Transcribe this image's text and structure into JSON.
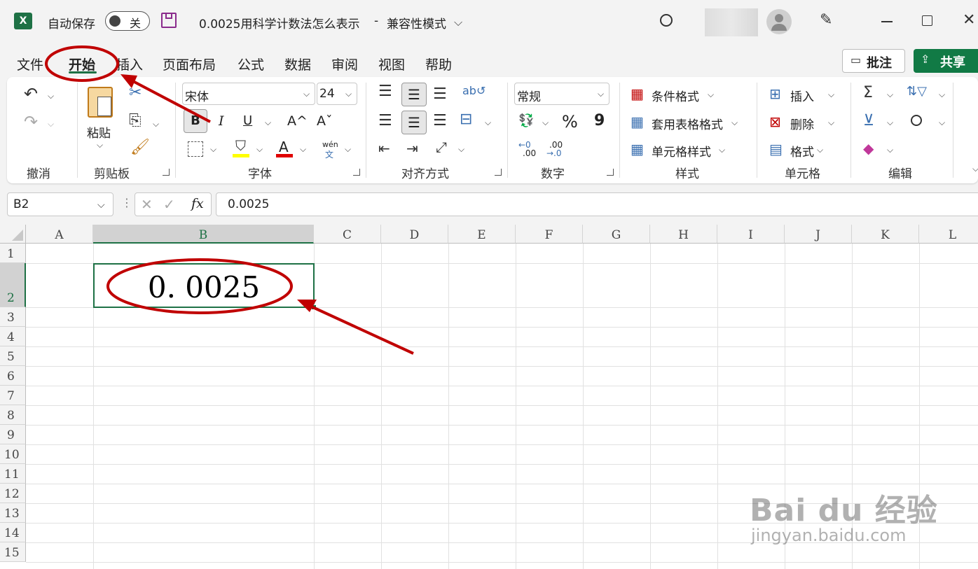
{
  "app": {
    "autosave_label": "自动保存",
    "autosave_state": "关",
    "doc_title": "0.0025用科学计数法怎么表示",
    "title_sep": "-",
    "mode": "兼容性模式"
  },
  "tabs": [
    "文件",
    "开始",
    "插入",
    "页面布局",
    "公式",
    "数据",
    "审阅",
    "视图",
    "帮助"
  ],
  "active_tab": "开始",
  "comments_label": "批注",
  "share_label": "共享",
  "ribbon": {
    "groups": {
      "undo": "撤消",
      "clipboard": "剪贴板",
      "font": "字体",
      "alignment": "对齐方式",
      "number": "数字",
      "styles": "样式",
      "cells": "单元格",
      "editing": "编辑"
    },
    "paste_label": "粘贴",
    "font_name": "宋体",
    "font_size": "24",
    "bold": "B",
    "italic": "I",
    "underline": "U",
    "grow": "A^",
    "shrink": "Aˇ",
    "phonetic_top": "wén",
    "phonetic_bottom": "文",
    "number_format": "常规",
    "percent": "%",
    "comma": "9",
    "dec_inc_top": "←0",
    "dec_inc_bottom": ".00",
    "dec_dec_top": ".00",
    "dec_dec_bottom": "→.0",
    "cond_format": "条件格式",
    "table_format": "套用表格格式",
    "cell_style": "单元格样式",
    "insert": "插入",
    "delete": "删除",
    "format": "格式",
    "wrap_label": "ab\nc"
  },
  "formula_bar": {
    "name_box": "B2",
    "fx": "fx",
    "value": "0.0025"
  },
  "grid": {
    "columns": [
      "A",
      "B",
      "C",
      "D",
      "E",
      "F",
      "G",
      "H",
      "I",
      "J",
      "K",
      "L"
    ],
    "rows": [
      "1",
      "2",
      "3",
      "4",
      "5",
      "6",
      "7",
      "8",
      "9",
      "10",
      "11",
      "12",
      "13",
      "14",
      "15"
    ],
    "cell_b2": "0. 0025"
  },
  "watermark": {
    "brand": "Bai du 经验",
    "url": "jingyan.baidu.com"
  },
  "colors": {
    "excel_green": "#1e7145",
    "share_green": "#117a45",
    "annotation_red": "#c00000"
  }
}
